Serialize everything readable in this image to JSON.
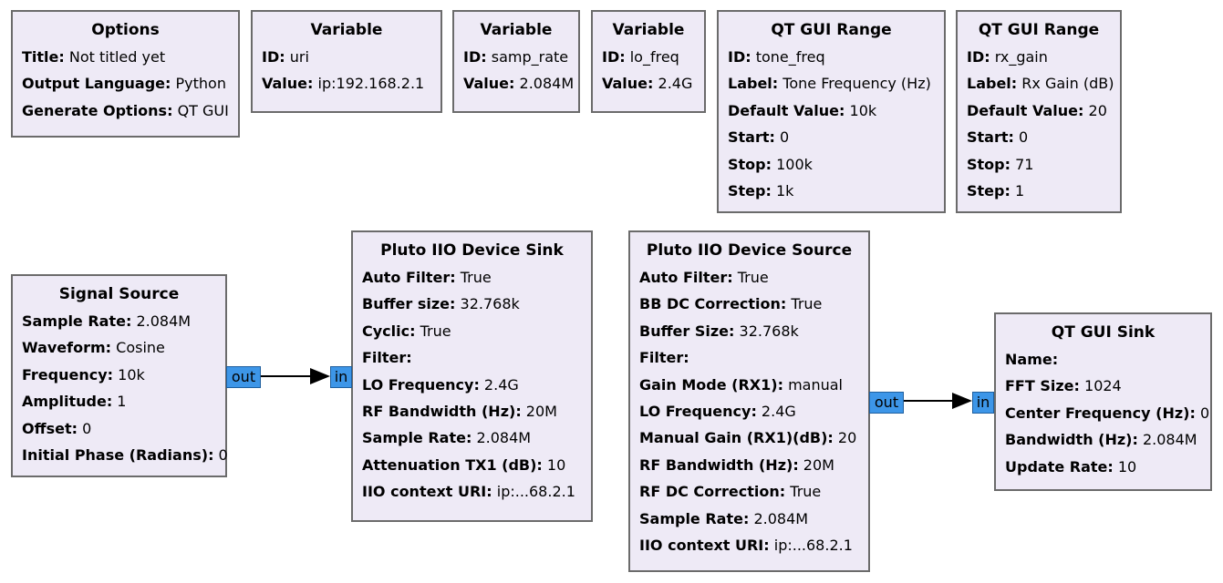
{
  "blocks": {
    "options": {
      "title": "Options",
      "params": [
        {
          "k": "Title:",
          "v": " Not titled yet"
        },
        {
          "k": "Output Language:",
          "v": " Python"
        },
        {
          "k": "Generate Options:",
          "v": " QT GUI"
        }
      ]
    },
    "var_uri": {
      "title": "Variable",
      "params": [
        {
          "k": "ID:",
          "v": " uri"
        },
        {
          "k": "Value:",
          "v": " ip:192.168.2.1"
        }
      ]
    },
    "var_samp_rate": {
      "title": "Variable",
      "params": [
        {
          "k": "ID:",
          "v": " samp_rate"
        },
        {
          "k": "Value:",
          "v": " 2.084M"
        }
      ]
    },
    "var_lo_freq": {
      "title": "Variable",
      "params": [
        {
          "k": "ID:",
          "v": " lo_freq"
        },
        {
          "k": "Value:",
          "v": " 2.4G"
        }
      ]
    },
    "range_tone": {
      "title": "QT GUI Range",
      "params": [
        {
          "k": "ID:",
          "v": " tone_freq"
        },
        {
          "k": "Label:",
          "v": " Tone Frequency (Hz)"
        },
        {
          "k": "Default Value:",
          "v": " 10k"
        },
        {
          "k": "Start:",
          "v": " 0"
        },
        {
          "k": "Stop:",
          "v": " 100k"
        },
        {
          "k": "Step:",
          "v": " 1k"
        }
      ]
    },
    "range_gain": {
      "title": "QT GUI Range",
      "params": [
        {
          "k": "ID:",
          "v": " rx_gain"
        },
        {
          "k": "Label:",
          "v": " Rx Gain (dB)"
        },
        {
          "k": "Default Value:",
          "v": " 20"
        },
        {
          "k": "Start:",
          "v": " 0"
        },
        {
          "k": "Stop:",
          "v": " 71"
        },
        {
          "k": "Step:",
          "v": " 1"
        }
      ]
    },
    "signal_source": {
      "title": "Signal Source",
      "params": [
        {
          "k": "Sample Rate:",
          "v": " 2.084M"
        },
        {
          "k": "Waveform:",
          "v": " Cosine"
        },
        {
          "k": "Frequency:",
          "v": " 10k"
        },
        {
          "k": "Amplitude:",
          "v": " 1"
        },
        {
          "k": "Offset:",
          "v": " 0"
        },
        {
          "k": "Initial Phase (Radians):",
          "v": " 0"
        }
      ]
    },
    "pluto_sink": {
      "title": "Pluto IIO Device Sink",
      "params": [
        {
          "k": "Auto Filter:",
          "v": " True"
        },
        {
          "k": "Buffer size:",
          "v": " 32.768k"
        },
        {
          "k": "Cyclic:",
          "v": " True"
        },
        {
          "k": "Filter:",
          "v": ""
        },
        {
          "k": "LO Frequency:",
          "v": " 2.4G"
        },
        {
          "k": "RF Bandwidth (Hz):",
          "v": " 20M"
        },
        {
          "k": "Sample Rate:",
          "v": " 2.084M"
        },
        {
          "k": "Attenuation TX1 (dB):",
          "v": " 10"
        },
        {
          "k": "IIO context URI:",
          "v": " ip:...68.2.1"
        }
      ]
    },
    "pluto_source": {
      "title": "Pluto IIO Device Source",
      "params": [
        {
          "k": "Auto Filter:",
          "v": " True"
        },
        {
          "k": "BB DC Correction:",
          "v": " True"
        },
        {
          "k": "Buffer Size:",
          "v": " 32.768k"
        },
        {
          "k": "Filter:",
          "v": ""
        },
        {
          "k": "Gain Mode (RX1):",
          "v": " manual"
        },
        {
          "k": "LO Frequency:",
          "v": " 2.4G"
        },
        {
          "k": "Manual Gain (RX1)(dB):",
          "v": " 20"
        },
        {
          "k": "RF Bandwidth (Hz):",
          "v": " 20M"
        },
        {
          "k": "RF DC Correction:",
          "v": " True"
        },
        {
          "k": "Sample Rate:",
          "v": " 2.084M"
        },
        {
          "k": "IIO context URI:",
          "v": " ip:...68.2.1"
        }
      ]
    },
    "qt_sink": {
      "title": "QT GUI Sink",
      "params": [
        {
          "k": "Name:",
          "v": ""
        },
        {
          "k": "FFT Size:",
          "v": " 1024"
        },
        {
          "k": "Center Frequency (Hz):",
          "v": " 0"
        },
        {
          "k": "Bandwidth (Hz):",
          "v": " 2.084M"
        },
        {
          "k": "Update Rate:",
          "v": " 10"
        }
      ]
    }
  },
  "ports": {
    "signal_source_out": "out",
    "pluto_sink_in": "in",
    "pluto_source_out": "out",
    "qt_sink_in": "in"
  },
  "colors": {
    "block_fill": "#eeeaf6",
    "block_border": "#6b6b6b",
    "port_fill": "#3d96e8",
    "wire": "#000000"
  }
}
